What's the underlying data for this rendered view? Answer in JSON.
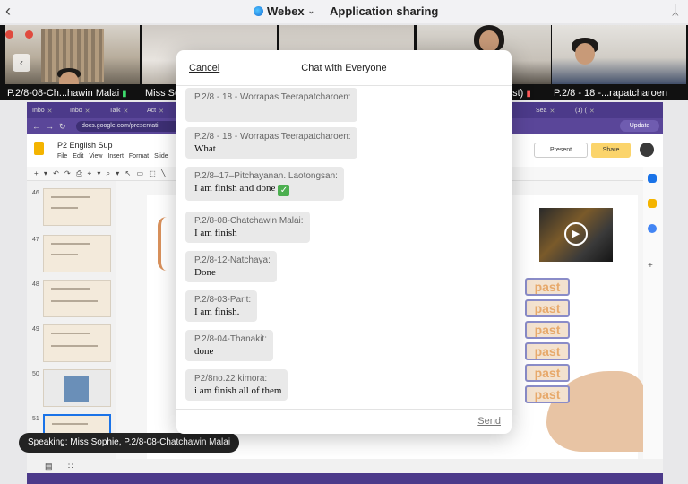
{
  "topbar": {
    "app_name": "Webex",
    "view_title": "Application sharing"
  },
  "videos": [
    {
      "name": "P.2/8-08-Ch...hawin Malai",
      "muted": false
    },
    {
      "name": "Miss So",
      "muted": false
    },
    {
      "name": "",
      "muted": false
    },
    {
      "name": "ost)",
      "muted": true
    },
    {
      "name": "P.2/8 - 18 -...rapatcharoen",
      "muted": false
    }
  ],
  "share": {
    "tabs": [
      "Inbo",
      "Inbo",
      "Talk",
      "Act",
      "Sea",
      "(1) ("
    ],
    "url": "docs.google.com/presentati",
    "update_label": "Update",
    "doc_title": "P2 English Sup",
    "menu": [
      "File",
      "Edit",
      "View",
      "Insert",
      "Format",
      "Slide"
    ],
    "present_label": "Present",
    "share_label": "Share",
    "slide_numbers": [
      "46",
      "47",
      "48",
      "49",
      "50",
      "51"
    ],
    "past_word": "past"
  },
  "speaking": "Speaking: Miss Sophie, P.2/8-08-Chatchawin Malai",
  "chat": {
    "cancel_label": "Cancel",
    "title": "Chat with Everyone",
    "send_label": "Send",
    "messages": [
      {
        "sender": "P.2/8 - 18 - Worrapas Teerapatcharoen:",
        "text": ""
      },
      {
        "sender": "P.2/8 - 18 - Worrapas Teerapatcharoen:",
        "text": "What"
      },
      {
        "sender": "P.2/8–17–Pitchayanan. Laotongsan:",
        "text": "I am finish and done"
      },
      {
        "sender": "P.2/8-08-Chatchawin Malai:",
        "text": "I am finish"
      },
      {
        "sender": "P.2/8-12-Natchaya:",
        "text": "Done"
      },
      {
        "sender": "P.2/8-03-Parit:",
        "text": "I am finish."
      },
      {
        "sender": "P.2/8-04-Thanakit:",
        "text": "done"
      },
      {
        "sender": "P2/8no.22 kimora:",
        "text": "i am finish all of them"
      }
    ]
  }
}
